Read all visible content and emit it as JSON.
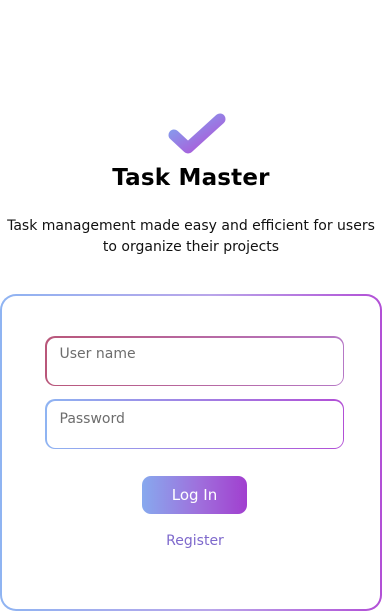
{
  "app": {
    "title": "Task Master",
    "subtitle": "Task management made easy and efficient for users to organize their projects"
  },
  "logo": {
    "icon": "check-mark-icon",
    "colors": [
      "#7fa6f0",
      "#b24fd6"
    ]
  },
  "form": {
    "username": {
      "placeholder": "User name",
      "value": ""
    },
    "password": {
      "placeholder": "Password",
      "value": ""
    },
    "login_label": "Log In",
    "register_label": "Register"
  },
  "colors": {
    "gradient_start": "#8fb4f2",
    "gradient_end": "#b24fd6",
    "link": "#7e69cc"
  }
}
